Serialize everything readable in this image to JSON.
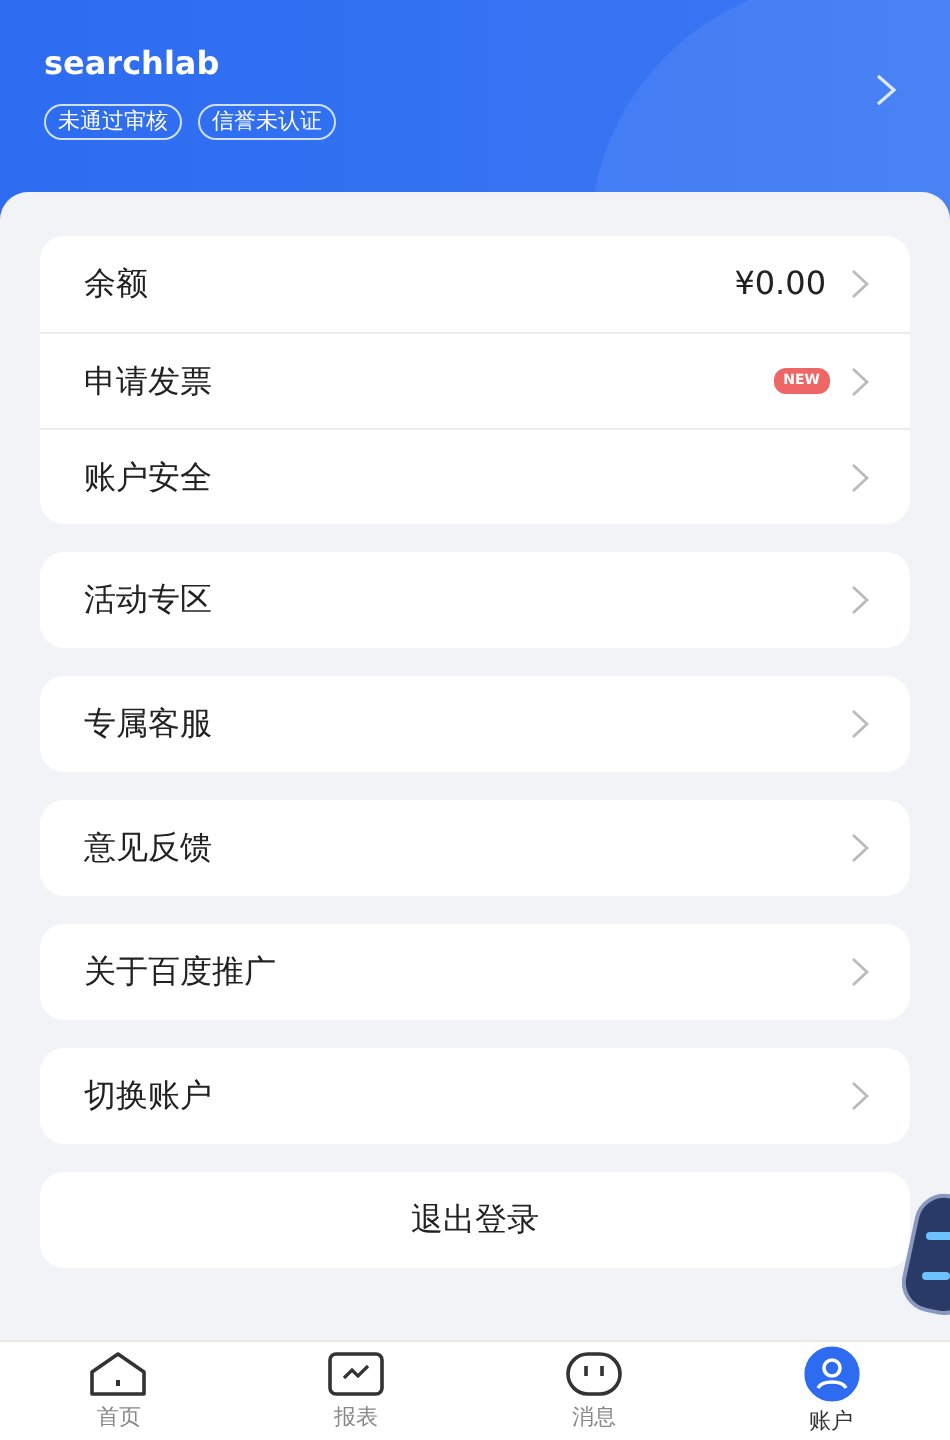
{
  "header": {
    "username": "searchlab",
    "tags": [
      "未通过审核",
      "信誉未认证"
    ]
  },
  "groups": [
    {
      "items": [
        {
          "label": "余额",
          "value": "¥0.00"
        },
        {
          "label": "申请发票",
          "badge": "NEW"
        },
        {
          "label": "账户安全"
        }
      ]
    },
    {
      "items": [
        {
          "label": "活动专区"
        }
      ]
    },
    {
      "items": [
        {
          "label": "专属客服"
        }
      ]
    },
    {
      "items": [
        {
          "label": "意见反馈"
        }
      ]
    },
    {
      "items": [
        {
          "label": "关于百度推广"
        }
      ]
    },
    {
      "items": [
        {
          "label": "切换账户"
        }
      ]
    }
  ],
  "logout_button": "退出登录",
  "tabs": [
    {
      "label": "首页",
      "kind": "home",
      "selected": false
    },
    {
      "label": "报表",
      "kind": "chart",
      "selected": false
    },
    {
      "label": "消息",
      "kind": "message",
      "selected": false
    },
    {
      "label": "账户",
      "kind": "account",
      "selected": true
    }
  ]
}
